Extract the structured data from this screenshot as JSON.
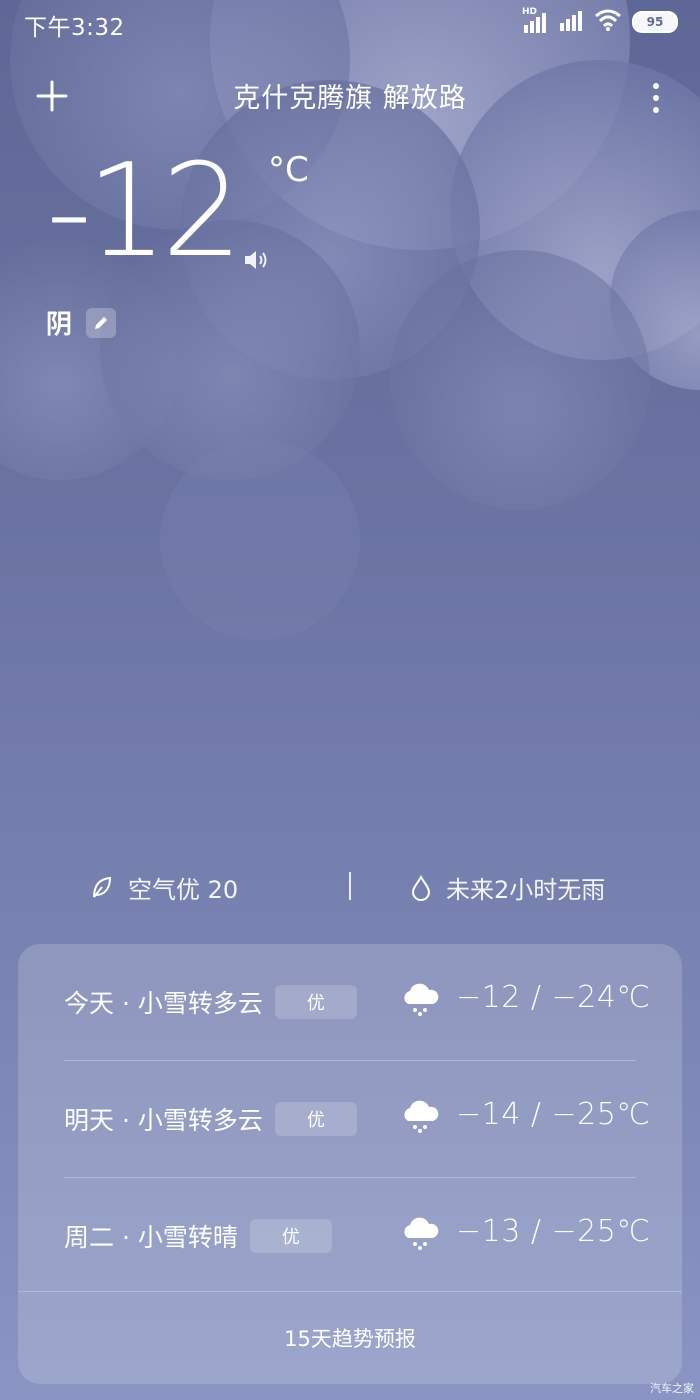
{
  "status_bar": {
    "time": "下午3:32",
    "hd_label": "HD",
    "battery": "95",
    "icons": [
      "hd-signal-icon",
      "signal-icon",
      "wifi-icon",
      "battery-icon"
    ]
  },
  "header": {
    "location": "克什克腾旗 解放路",
    "add_icon": "plus-icon",
    "more_icon": "more-vertical-icon"
  },
  "current": {
    "temperature": "-12",
    "unit": "°C",
    "condition": "阴",
    "speaker_icon": "speaker-icon",
    "edit_icon": "pencil-icon"
  },
  "info": {
    "air_quality": "空气优 20",
    "air_icon": "leaf-icon",
    "rain": "未来2小时无雨",
    "rain_icon": "drop-icon"
  },
  "forecast": {
    "days": [
      {
        "label": "今天 · 小雪转多云",
        "aqi": "优",
        "icon": "snow-cloud-icon",
        "range": "−12  /  −24℃"
      },
      {
        "label": "明天 · 小雪转多云",
        "aqi": "优",
        "icon": "snow-cloud-icon",
        "range": "−14  /  −25℃"
      },
      {
        "label": "周二 · 小雪转晴",
        "aqi": "优",
        "icon": "snow-cloud-icon",
        "range": "−13  /  −25℃"
      }
    ],
    "trend_button": "15天趋势预报"
  },
  "watermark": "汽车之家",
  "colors": {
    "background_top": "#5f6796",
    "background_bottom": "#8a95c3",
    "text": "#ffffff"
  }
}
